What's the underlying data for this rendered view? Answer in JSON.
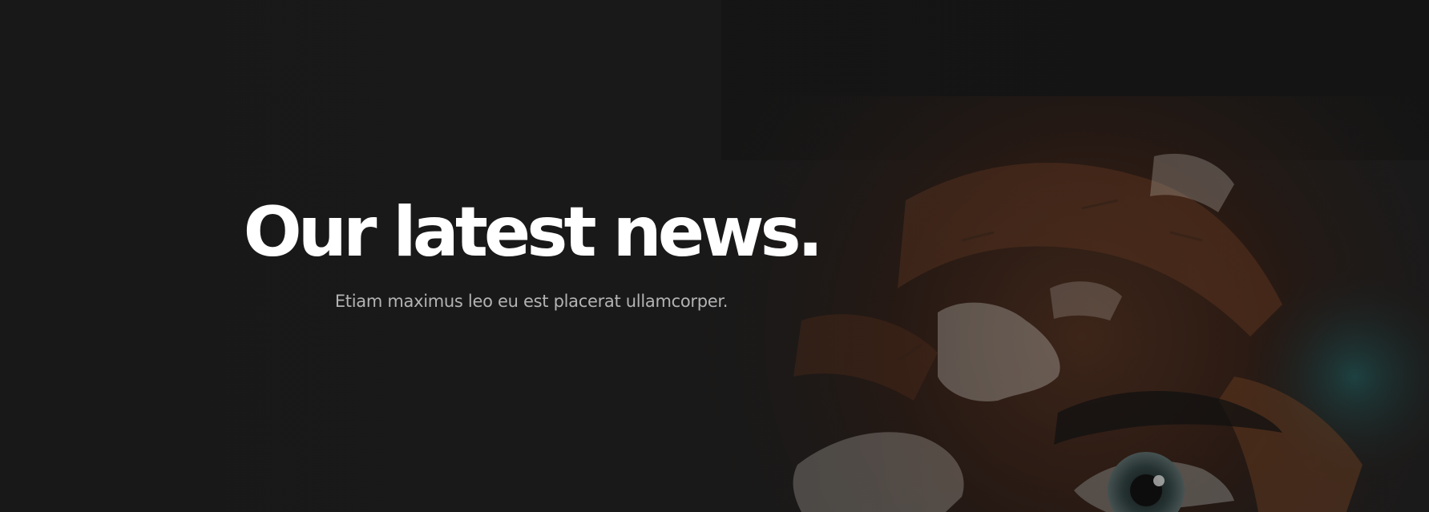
{
  "hero": {
    "title": "Our latest news.",
    "subtitle": "Etiam maximus leo eu est placerat ullamcorper."
  },
  "colors": {
    "background": "#1b1b1b",
    "title": "#ffffff",
    "subtitle": "#b3b3b3",
    "paint_orange": "#6b3a20",
    "paint_white": "#d9d2c7",
    "paint_teal": "#1f4a4a"
  }
}
